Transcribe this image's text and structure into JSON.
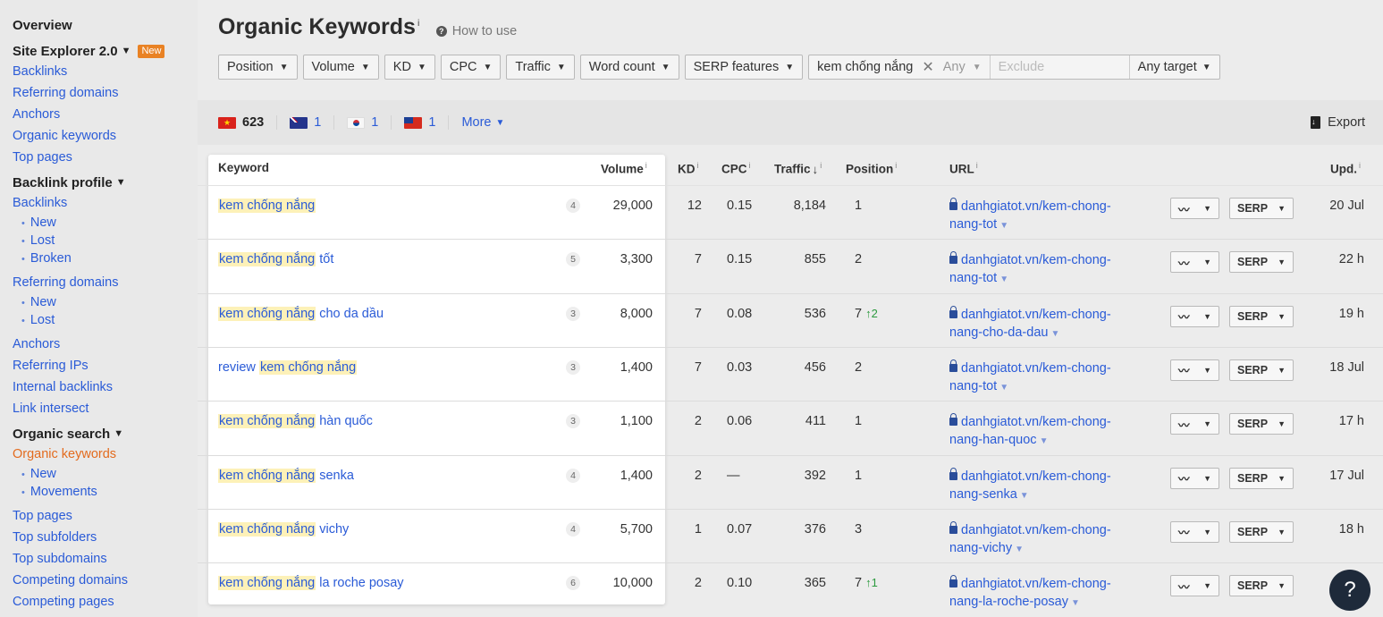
{
  "sidebar": {
    "overview": "Overview",
    "site_explorer": "Site Explorer 2.0",
    "new_badge": "New",
    "items1": [
      "Backlinks",
      "Referring domains",
      "Anchors",
      "Organic keywords",
      "Top pages"
    ],
    "backlink_profile": "Backlink profile",
    "backlinks": "Backlinks",
    "backlinks_sub": [
      "New",
      "Lost",
      "Broken"
    ],
    "referring_domains": "Referring domains",
    "rd_sub": [
      "New",
      "Lost"
    ],
    "items2": [
      "Anchors",
      "Referring IPs",
      "Internal backlinks",
      "Link intersect"
    ],
    "organic_search": "Organic search",
    "organic_keywords": "Organic keywords",
    "ok_sub": [
      "New",
      "Movements"
    ],
    "items3": [
      "Top pages",
      "Top subfolders",
      "Top subdomains",
      "Competing domains",
      "Competing pages"
    ]
  },
  "header": {
    "title": "Organic Keywords",
    "how_to": "How to use"
  },
  "filters": {
    "buttons": [
      "Position",
      "Volume",
      "KD",
      "CPC",
      "Traffic",
      "Word count",
      "SERP features"
    ],
    "keyword_value": "kem chống nắng",
    "any": "Any",
    "exclude_placeholder": "Exclude",
    "any_target": "Any target"
  },
  "countries": [
    {
      "flag": "vn",
      "count": "623"
    },
    {
      "flag": "au",
      "count": "1"
    },
    {
      "flag": "kr",
      "count": "1"
    },
    {
      "flag": "tw",
      "count": "1"
    }
  ],
  "more": "More",
  "export": "Export",
  "columns": {
    "keyword": "Keyword",
    "volume": "Volume",
    "kd": "KD",
    "cpc": "CPC",
    "traffic": "Traffic",
    "position": "Position",
    "url": "URL",
    "upd": "Upd."
  },
  "serp_label": "SERP",
  "help": "?",
  "rows": [
    {
      "pre": "",
      "hl": "kem chống nắng",
      "post": "",
      "count": "4",
      "volume": "29,000",
      "kd": "12",
      "cpc": "0.15",
      "traffic": "8,184",
      "position": "1",
      "change": "",
      "url1": "danhgiatot.vn/kem-chong-",
      "url2": "nang-tot",
      "upd": "20 Jul"
    },
    {
      "pre": "",
      "hl": "kem chống nắng",
      "post": " tốt",
      "count": "5",
      "volume": "3,300",
      "kd": "7",
      "cpc": "0.15",
      "traffic": "855",
      "position": "2",
      "change": "",
      "url1": "danhgiatot.vn/kem-chong-",
      "url2": "nang-tot",
      "upd": "22 h"
    },
    {
      "pre": "",
      "hl": "kem chống nắng",
      "post": " cho da dầu",
      "count": "3",
      "volume": "8,000",
      "kd": "7",
      "cpc": "0.08",
      "traffic": "536",
      "position": "7",
      "change": "2",
      "url1": "danhgiatot.vn/kem-chong-",
      "url2": "nang-cho-da-dau",
      "upd": "19 h"
    },
    {
      "pre": "review ",
      "hl": "kem chống nắng",
      "post": "",
      "count": "3",
      "volume": "1,400",
      "kd": "7",
      "cpc": "0.03",
      "traffic": "456",
      "position": "2",
      "change": "",
      "url1": "danhgiatot.vn/kem-chong-",
      "url2": "nang-tot",
      "upd": "18 Jul"
    },
    {
      "pre": "",
      "hl": "kem chống nắng",
      "post": " hàn quốc",
      "count": "3",
      "volume": "1,100",
      "kd": "2",
      "cpc": "0.06",
      "traffic": "411",
      "position": "1",
      "change": "",
      "url1": "danhgiatot.vn/kem-chong-",
      "url2": "nang-han-quoc",
      "upd": "17 h"
    },
    {
      "pre": "",
      "hl": "kem chống nắng",
      "post": " senka",
      "count": "4",
      "volume": "1,400",
      "kd": "2",
      "cpc": "—",
      "traffic": "392",
      "position": "1",
      "change": "",
      "url1": "danhgiatot.vn/kem-chong-",
      "url2": "nang-senka",
      "upd": "17 Jul"
    },
    {
      "pre": "",
      "hl": "kem chống nắng",
      "post": " vichy",
      "count": "4",
      "volume": "5,700",
      "kd": "1",
      "cpc": "0.07",
      "traffic": "376",
      "position": "3",
      "change": "",
      "url1": "danhgiatot.vn/kem-chong-",
      "url2": "nang-vichy",
      "upd": "18 h"
    },
    {
      "pre": "",
      "hl": "kem chống nắng",
      "post": " la roche posay",
      "count": "6",
      "volume": "10,000",
      "kd": "2",
      "cpc": "0.10",
      "traffic": "365",
      "position": "7",
      "change": "1",
      "url1": "danhgiatot.vn/kem-chong-",
      "url2": "nang-la-roche-posay",
      "upd": ""
    }
  ]
}
